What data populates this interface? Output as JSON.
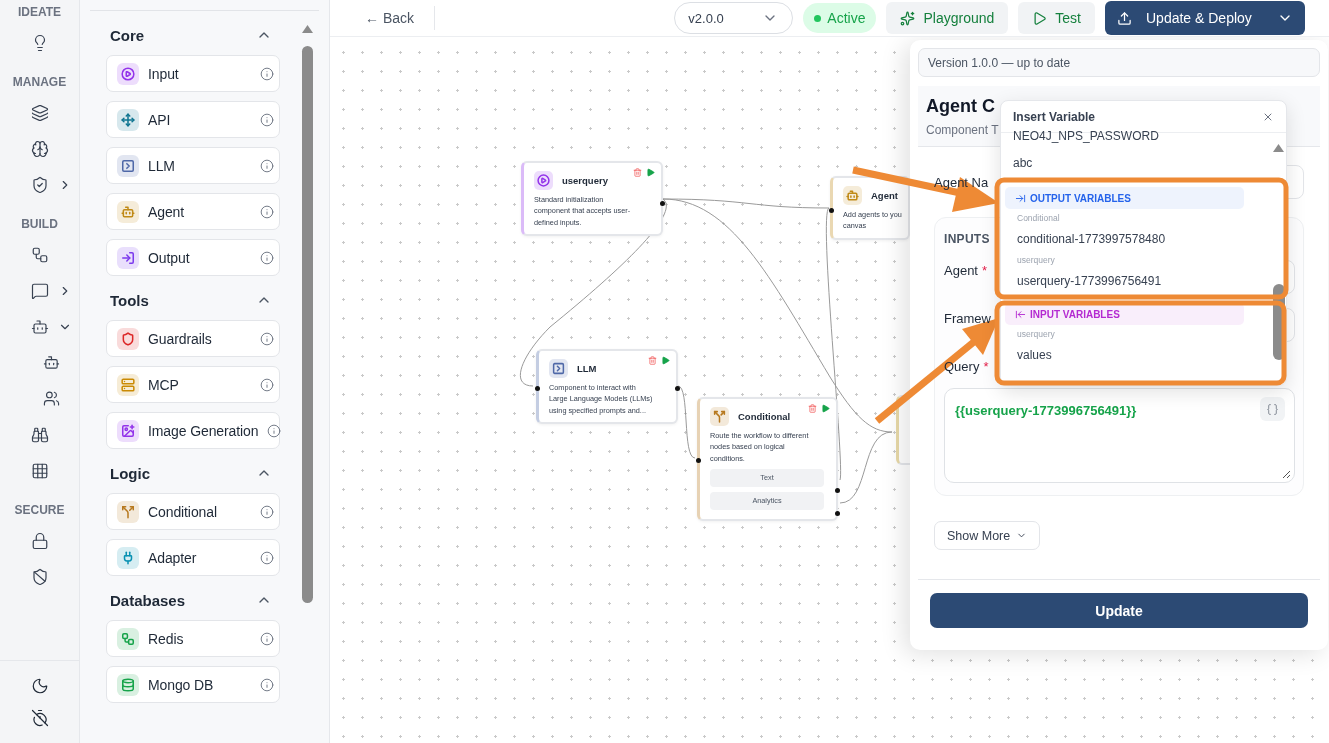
{
  "rail": {
    "sections": [
      {
        "label": "IDEATE",
        "items": [
          {
            "kind": "link"
          }
        ]
      },
      {
        "label": "MANAGE",
        "items": [
          {
            "kind": "link"
          },
          {
            "kind": "link"
          },
          {
            "kind": "group",
            "expanded": false
          }
        ]
      },
      {
        "label": "BUILD",
        "items": [
          {
            "kind": "link"
          },
          {
            "kind": "group",
            "expanded": false
          },
          {
            "kind": "group",
            "expanded": true,
            "children": [
              {
                "kind": "link"
              },
              {
                "kind": "link"
              }
            ]
          },
          {
            "kind": "link"
          },
          {
            "kind": "link"
          }
        ]
      },
      {
        "label": "SECURE",
        "items": [
          {
            "kind": "link"
          },
          {
            "kind": "link"
          }
        ]
      }
    ]
  },
  "palette": {
    "sections": [
      {
        "title": "Core",
        "expanded": true,
        "items": [
          {
            "label": "Input",
            "color": "#9333ea"
          },
          {
            "label": "API",
            "color": "#0e7490"
          },
          {
            "label": "LLM",
            "color": "#4f68a8"
          },
          {
            "label": "Agent",
            "color": "#c08a17"
          },
          {
            "label": "Output",
            "color": "#7c3aed"
          }
        ]
      },
      {
        "title": "Tools",
        "expanded": true,
        "items": [
          {
            "label": "Guardrails",
            "color": "#dc2626"
          },
          {
            "label": "MCP",
            "color": "#ca8a04"
          },
          {
            "label": "Image Generation",
            "color": "#9333ea"
          }
        ]
      },
      {
        "title": "Logic",
        "expanded": true,
        "items": [
          {
            "label": "Conditional",
            "color": "#b7791f"
          },
          {
            "label": "Adapter",
            "color": "#0891b2"
          }
        ]
      },
      {
        "title": "Databases",
        "expanded": true,
        "items": [
          {
            "label": "Redis",
            "color": "#16a34a"
          },
          {
            "label": "Mongo DB",
            "color": "#16a34a"
          }
        ]
      }
    ]
  },
  "topbar": {
    "back": "← Back",
    "version": "v2.0.0",
    "status": "Active",
    "playground": "Playground",
    "test": "Test",
    "deploy": "Update & Deploy"
  },
  "canvas": {
    "nodes": [
      {
        "title": "userquery",
        "lines": [
          "Standard initialization",
          "component that accepts user-",
          "defined inputs."
        ],
        "color": "#9333ea",
        "actions": true
      },
      {
        "title": "Agent",
        "lines": [
          "Add agents to you",
          "canvas"
        ],
        "color": "#c08a17",
        "actions": false
      },
      {
        "title": "LLM",
        "lines": [
          "Component to interact with",
          "Large Language Models (LLMs)",
          "using specified prompts and..."
        ],
        "color": "#4f68a8",
        "actions": true
      },
      {
        "title": "Conditional",
        "lines": [
          "Route the workflow to different",
          "nodes based on logical",
          "conditions."
        ],
        "color": "#b7791f",
        "actions": true,
        "outputs": [
          "Text",
          "Analytics"
        ]
      }
    ]
  },
  "panel": {
    "version_note": "Version 1.0.0 — up to date",
    "title": "Agent C",
    "subtitle": "Component T",
    "name_label": "Agent Na",
    "inputs": {
      "heading": "INPUTS",
      "fields": [
        {
          "label": "Agent",
          "required_mark": "*"
        },
        {
          "label": "Framew"
        },
        {
          "label": "Query",
          "required_mark": "*"
        }
      ],
      "query_value": "{{userquery-1773996756491}}"
    },
    "show_more": "Show More",
    "submit": "Update"
  },
  "popup": {
    "title": "Insert Variable",
    "items": [
      {
        "kind": "option",
        "label": "NEO4J_NPS_PASSWORD"
      },
      {
        "kind": "option",
        "label": "abc"
      },
      {
        "kind": "outputs",
        "label": "OUTPUT VARIABLES",
        "color": "#2563eb"
      },
      {
        "kind": "group",
        "label": "Conditional"
      },
      {
        "kind": "option",
        "label": "conditional-1773997578480"
      },
      {
        "kind": "group",
        "label": "userquery"
      },
      {
        "kind": "option",
        "label": "userquery-1773996756491"
      },
      {
        "kind": "inputs",
        "label": "INPUT VARIABLES",
        "color": "#b42ad1"
      },
      {
        "kind": "group",
        "label": "userquery"
      },
      {
        "kind": "option",
        "label": "values"
      }
    ]
  }
}
